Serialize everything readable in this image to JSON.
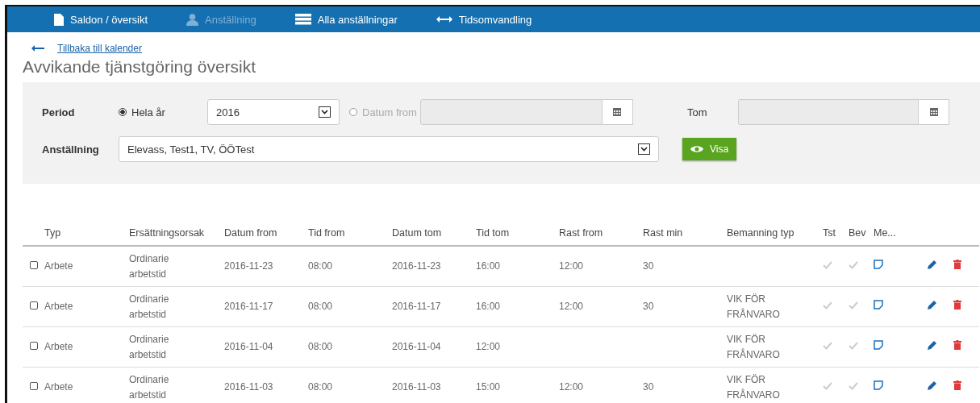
{
  "nav": [
    {
      "label": "Saldon / översikt",
      "kind": "document",
      "disabled": false
    },
    {
      "label": "Anställning",
      "kind": "person",
      "disabled": true
    },
    {
      "label": "Alla anställningar",
      "kind": "list",
      "disabled": false
    },
    {
      "label": "Tidsomvandling",
      "kind": "arrows",
      "disabled": false
    }
  ],
  "back_link": "Tillbaka till kalender",
  "title": "Avvikande tjänstgöring översikt",
  "filter": {
    "period_label": "Period",
    "options": [
      {
        "label": "Hela år",
        "selected": true
      },
      {
        "label": "Datum from",
        "selected": false
      }
    ],
    "year": "2016",
    "tom_label": "Tom",
    "employment_label": "Anställning",
    "employment": "Elevass, Test1, TV, ÖÖTest",
    "show_button": "Visa"
  },
  "table": {
    "columns": [
      "Typ",
      "Ersättningsorsak",
      "Datum from",
      "Tid from",
      "Datum tom",
      "Tid tom",
      "Rast from",
      "Rast min",
      "Bemanning typ",
      "Tst",
      "Bev",
      "Me..."
    ],
    "rows": [
      {
        "checked": false,
        "cells": [
          "Arbete",
          "Ordinarie arbetstid",
          "2016-11-23",
          "08:00",
          "2016-11-23",
          "16:00",
          "12:00",
          "30",
          ""
        ]
      },
      {
        "checked": false,
        "cells": [
          "Arbete",
          "Ordinarie arbetstid",
          "2016-11-17",
          "08:00",
          "2016-11-17",
          "16:00",
          "12:00",
          "30",
          "VIK FÖR FRÅNVARO"
        ]
      },
      {
        "checked": false,
        "cells": [
          "Arbete",
          "Ordinarie arbetstid",
          "2016-11-04",
          "08:00",
          "2016-11-04",
          "12:00",
          "",
          "",
          "VIK FÖR FRÅNVARO"
        ]
      },
      {
        "checked": false,
        "cells": [
          "Arbete",
          "Ordinarie arbetstid",
          "2016-11-03",
          "08:00",
          "2016-11-03",
          "15:00",
          "12:00",
          "30",
          "VIK FÖR FRÅNVARO"
        ]
      }
    ]
  }
}
